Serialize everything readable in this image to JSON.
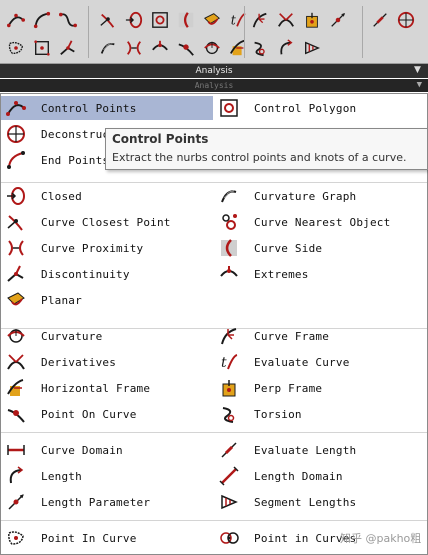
{
  "toolbar": {
    "buttons": [
      "control-points-icon",
      "curve-icon",
      "s-curve-icon",
      "curve-closest-point-icon",
      "closed-icon",
      "control-polygon-icon",
      "seam-icon",
      "planar-icon",
      "evaluate-curve-icon",
      "curve-frame-icon",
      "derivatives-icon",
      "perp-frame-icon",
      "length-parameter-icon",
      "evaluate-length-icon",
      "deconstruct-icon",
      "point-in-curve-icon",
      "square-icon",
      "discontinuity-icon",
      "curvature-graph-icon",
      "curve-proximity-icon",
      "extremes-icon",
      "point-on-curve-icon",
      "curvature-icon",
      "horizontal-frame-icon",
      "torsion-icon",
      "length-icon",
      "segment-lengths-icon"
    ],
    "panel_label": "Analysis",
    "ghost_label": "Analysis"
  },
  "menu": {
    "items": [
      {
        "icon": "control-points-icon",
        "label": "Control Points",
        "selected": true
      },
      {
        "icon": "control-polygon-icon",
        "label": "Control Polygon"
      },
      {
        "icon": "deconstruct-icon",
        "label": "Deconstruct"
      },
      {
        "icon": "end-points-icon",
        "label": "End Points"
      },
      {
        "icon": "closed-icon",
        "label": "Closed"
      },
      {
        "icon": "curvature-graph-icon",
        "label": "Curvature Graph"
      },
      {
        "icon": "curve-closest-point-icon",
        "label": "Curve Closest Point"
      },
      {
        "icon": "curve-nearest-object-icon",
        "label": "Curve Nearest Object"
      },
      {
        "icon": "curve-proximity-icon",
        "label": "Curve Proximity"
      },
      {
        "icon": "curve-side-icon",
        "label": "Curve Side"
      },
      {
        "icon": "discontinuity-icon",
        "label": "Discontinuity"
      },
      {
        "icon": "extremes-icon",
        "label": "Extremes"
      },
      {
        "icon": "planar-icon",
        "label": "Planar"
      },
      {
        "icon": "curvature-icon",
        "label": "Curvature"
      },
      {
        "icon": "curve-frame-icon",
        "label": "Curve Frame"
      },
      {
        "icon": "derivatives-icon",
        "label": "Derivatives"
      },
      {
        "icon": "evaluate-curve-icon",
        "label": "Evaluate Curve"
      },
      {
        "icon": "horizontal-frame-icon",
        "label": "Horizontal Frame"
      },
      {
        "icon": "perp-frame-icon",
        "label": "Perp Frame"
      },
      {
        "icon": "point-on-curve-icon",
        "label": "Point On Curve"
      },
      {
        "icon": "torsion-icon",
        "label": "Torsion"
      },
      {
        "icon": "curve-domain-icon",
        "label": "Curve Domain"
      },
      {
        "icon": "evaluate-length-icon",
        "label": "Evaluate Length"
      },
      {
        "icon": "length-icon",
        "label": "Length"
      },
      {
        "icon": "length-domain-icon",
        "label": "Length Domain"
      },
      {
        "icon": "length-parameter-icon",
        "label": "Length Parameter"
      },
      {
        "icon": "segment-lengths-icon",
        "label": "Segment Lengths"
      },
      {
        "icon": "point-in-curve-icon",
        "label": "Point In Curve"
      },
      {
        "icon": "point-in-curves-icon",
        "label": "Point in Curves"
      }
    ]
  },
  "tooltip": {
    "title": "Control Points",
    "description": "Extract the nurbs control points and knots of a curve."
  },
  "watermark": "知乎 @pakho粗",
  "colors": {
    "accent_red": "#b01818",
    "selection": "#a9b6d4",
    "bar": "#2f2f2f"
  }
}
